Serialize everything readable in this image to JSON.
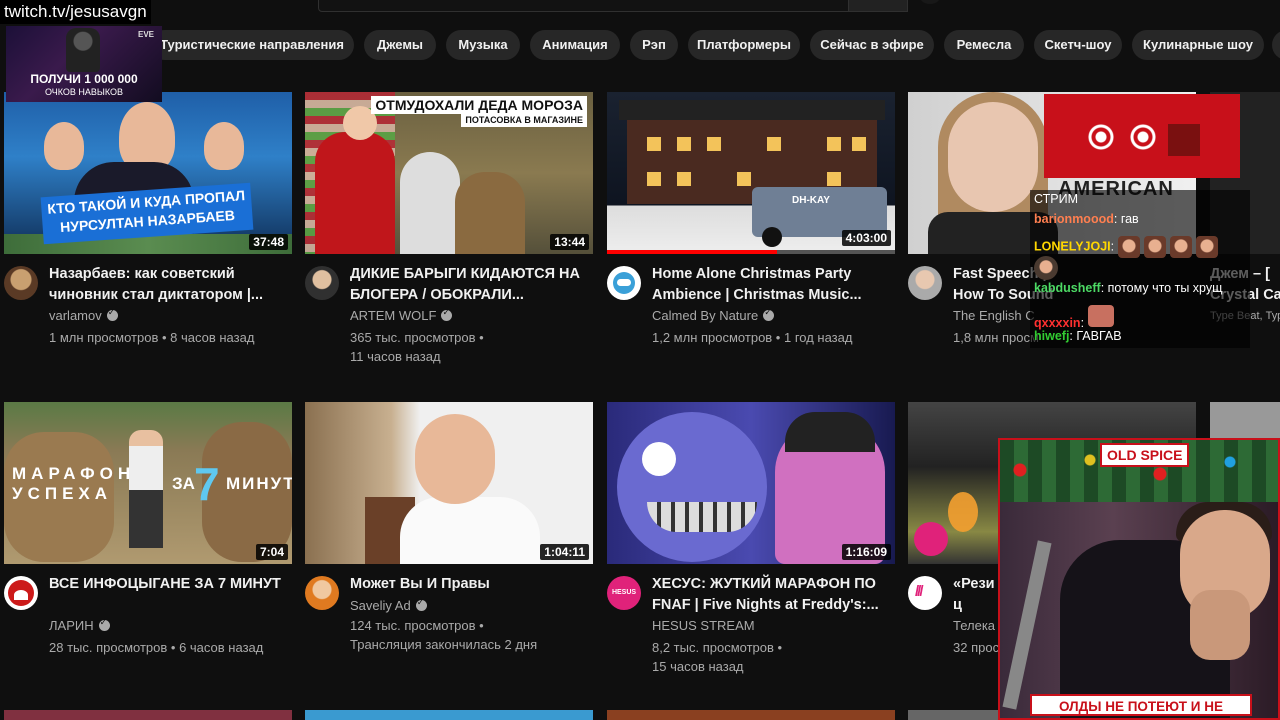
{
  "overlay": {
    "twitch_url": "twitch.tv/jesusavgn",
    "promo": {
      "brand": "EVE",
      "line1": "ПОЛУЧИ 1 000 000",
      "line2": "ОЧКОВ НАВЫКОВ"
    }
  },
  "chips": [
    "Туристические направления",
    "Джемы",
    "Музыка",
    "Анимация",
    "Рэп",
    "Платформеры",
    "Сейчас в эфире",
    "Ремесла",
    "Скетч-шоу",
    "Кулинарные шоу"
  ],
  "videos": [
    {
      "title": "Назарбаев: как советский чиновник стал диктатором |...",
      "channel": "varlamov",
      "verified": true,
      "meta_line1": "1 млн просмотров • 8 часов назад",
      "meta_line2": "",
      "duration": "37:48",
      "thumb_text": "КТО ТАКОЙ И КУДА ПРОПАЛ НУРСУЛТАН НАЗАРБАЕВ"
    },
    {
      "title": "ДИКИЕ БАРЫГИ КИДАЮТСЯ НА БЛОГЕРА / ОБОКРАЛИ...",
      "channel": "ARTEM WOLF",
      "verified": true,
      "meta_line1": "365 тыс. просмотров •",
      "meta_line2": "11 часов назад",
      "duration": "13:44",
      "thumb_text": "ОТМУДОХАЛИ ДЕДА МОРОЗА",
      "thumb_subtext": "ПОТАСОВКА В МАГАЗИНЕ"
    },
    {
      "title": "Home Alone Christmas Party Ambience | Christmas Music...",
      "channel": "Calmed By Nature",
      "verified": true,
      "meta_line1": "1,2 млн просмотров • 1 год назад",
      "meta_line2": "",
      "duration": "4:03:00",
      "thumb_text": "DH-KAY"
    },
    {
      "title": "Fast Speech | How To Sound Like A Native English Speaker",
      "channel": "The English C",
      "verified": false,
      "meta_line1": "1,8 млн просм",
      "meta_line2": "",
      "duration": "",
      "thumb_text": "AMERICAN"
    },
    {
      "title": "ВСЕ ИНФОЦЫГАНЕ ЗА 7 МИНУТ",
      "channel": "ЛАРИН",
      "verified": true,
      "meta_line1": "28 тыс. просмотров • 6 часов назад",
      "meta_line2": "",
      "duration": "7:04",
      "thumb_line1": "МАРАФОН",
      "thumb_line2": "УСПЕХА",
      "thumb_za": "ЗА",
      "thumb_seven": "7",
      "thumb_min": "МИНУТ"
    },
    {
      "title": "Может Вы И Правы",
      "channel": "Saveliy Ad",
      "verified": true,
      "meta_line1": "124 тыс. просмотров •",
      "meta_line2": "Трансляция закончилась 2 дня",
      "duration": "1:04:11"
    },
    {
      "title": "ХЕСУС: ЖУТКИЙ МАРАФОН ПО FNAF | Five Nights at Freddy's:...",
      "channel": "HESUS STREAM",
      "verified": false,
      "meta_line1": "8,2 тыс. просмотров •",
      "meta_line2": "15 часов назад",
      "duration": "1:16:09",
      "avatar_text": "HESUS"
    },
    {
      "title": "«Рези весь ц",
      "channel": "Телека",
      "verified": false,
      "meta_line1": "32 прос",
      "meta_line2": "",
      "duration": ""
    }
  ],
  "right_partial": {
    "title1": "Джем – [",
    "title2": "Crystal Ca",
    "meta": "Type Beat, Тур"
  },
  "chat": {
    "header": "СТРИМ",
    "messages": [
      {
        "user": "barionmoood",
        "user_color": "#ff7f50",
        "text": "гав"
      },
      {
        "user": "LONELYJOJI",
        "user_color": "#ffd700",
        "text": ""
      },
      {
        "user": "kabdusheff",
        "user_color": "#4cd964",
        "text": "потому что ты хрущ"
      },
      {
        "user": "qxxxxin",
        "user_color": "#ff3030",
        "text": ""
      },
      {
        "user": "hiwefj",
        "user_color": "#32cd32",
        "text": "ГАВГАВ"
      }
    ]
  },
  "cam": {
    "badge": "OLD SPICE",
    "footer": "ОЛДЫ НЕ ПОТЕЮТ И НЕ МЁРЗНУТ"
  }
}
